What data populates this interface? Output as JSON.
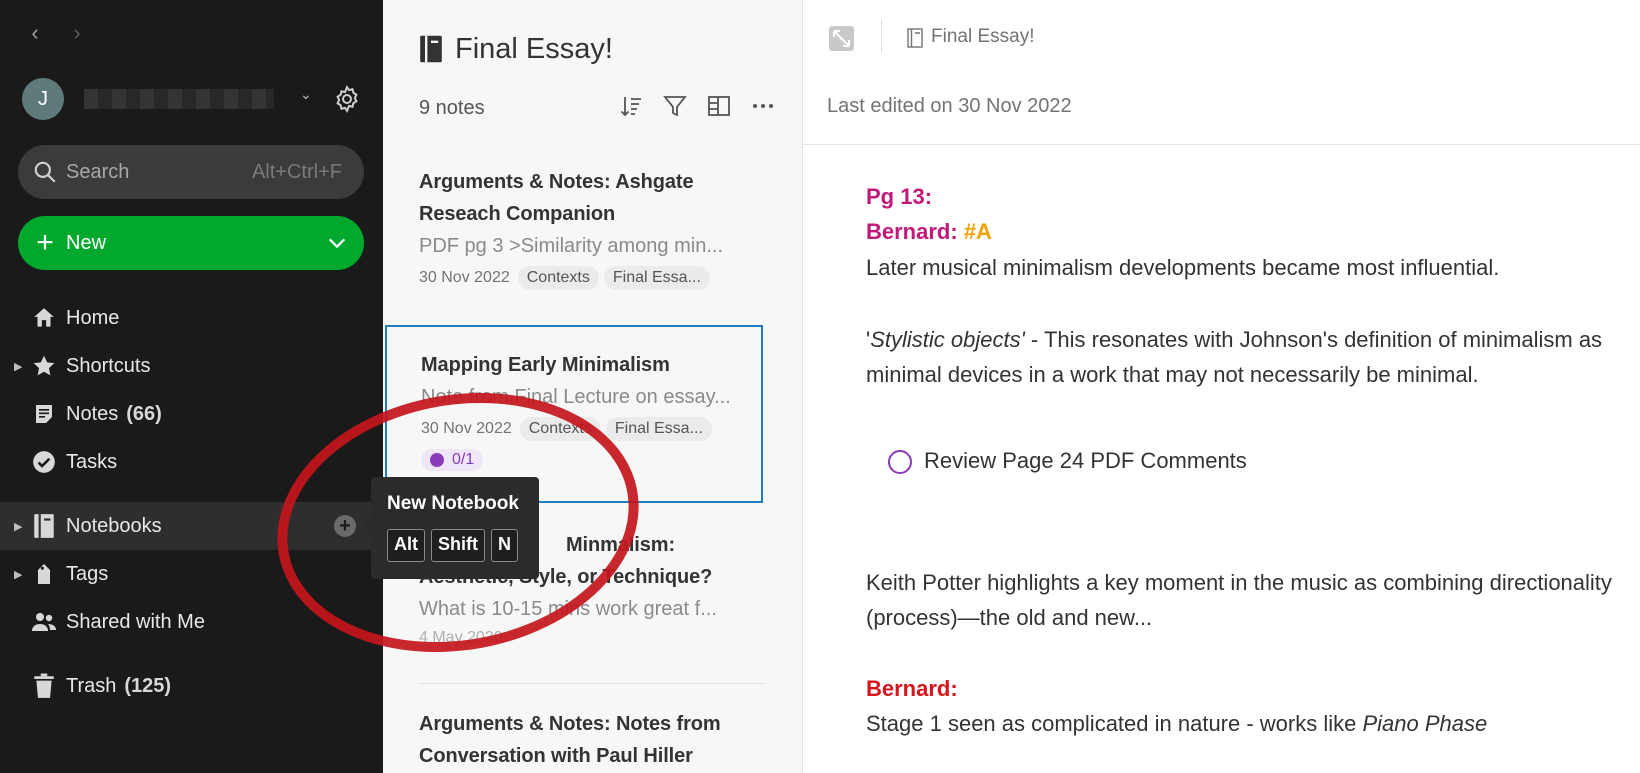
{
  "sidebar": {
    "nav_back": "‹",
    "nav_forward": "›",
    "avatar_initial": "J",
    "search": {
      "label": "Search",
      "shortcut": "Alt+Ctrl+F"
    },
    "new_button": {
      "label": "New"
    },
    "items": [
      {
        "label": "Home",
        "icon": "home-icon"
      },
      {
        "label": "Shortcuts",
        "icon": "star-icon"
      },
      {
        "label": "Notes",
        "count": "(66)",
        "icon": "note-icon"
      },
      {
        "label": "Tasks",
        "icon": "check-circle-icon"
      },
      {
        "label": "Notebooks",
        "icon": "notebook-icon"
      },
      {
        "label": "Tags",
        "icon": "tag-icon"
      },
      {
        "label": "Shared with Me",
        "icon": "people-icon"
      },
      {
        "label": "Trash",
        "count": "(125)",
        "icon": "trash-icon"
      }
    ]
  },
  "tooltip": {
    "title": "New Notebook",
    "keys": [
      "Alt",
      "Shift",
      "N"
    ]
  },
  "notelist": {
    "title": "Final Essay!",
    "count": "9 notes",
    "notes": [
      {
        "title": "Arguments & Notes: Ashgate Reseach Companion",
        "snippet": "PDF pg 3 >Similarity among min...",
        "date": "30 Nov 2022",
        "tags": [
          "Contexts",
          "Final Essa..."
        ]
      },
      {
        "title": "Mapping Early Minimalism",
        "snippet": "Note from Final Lecture on essay...",
        "date": "30 Nov 2022",
        "tags": [
          "Contexts",
          "Final Essa..."
        ],
        "task": "0/1"
      },
      {
        "title_line1": "Minmalism:",
        "title_line2": "Aesthetic, Style, or Technique?",
        "snippet": "What is 10-15 mins work great f...",
        "date": "4 May 2020"
      },
      {
        "title": "Arguments & Notes: Notes from Conversation with Paul Hiller"
      }
    ]
  },
  "editor": {
    "notebook": "Final Essay!",
    "last_edited": "Last edited on 30 Nov 2022",
    "content": {
      "pg": "Pg 13:",
      "bernard1": "Bernard:",
      "hashtag": "#A",
      "line1": "Later musical minimalism developments became most influential.",
      "quote_open": "'",
      "quote_italic": "Stylistic objects'",
      "quote_rest": " - This resonates with Johnson's definition of minimalism as",
      "line3": "minimal devices in a work that may not necessarily be minimal.",
      "task": "Review Page 24 PDF Comments",
      "line4": "Keith Potter highlights a key moment in the music as combining directionality",
      "line5": "(process)—the old and new...",
      "bernard2": "Bernard:",
      "line6_plain": "Stage 1 seen as complicated in nature - works like ",
      "line6_italic": "Piano Phase"
    }
  },
  "colors": {
    "sidebar_bg": "#1a1a1a",
    "new_button": "#00a82d",
    "selection_border": "#1f7fbf",
    "heading_pink": "#c2187a",
    "tag_orange": "#f2a200",
    "heading_red": "#d6151c",
    "annotation": "#c3151c"
  }
}
